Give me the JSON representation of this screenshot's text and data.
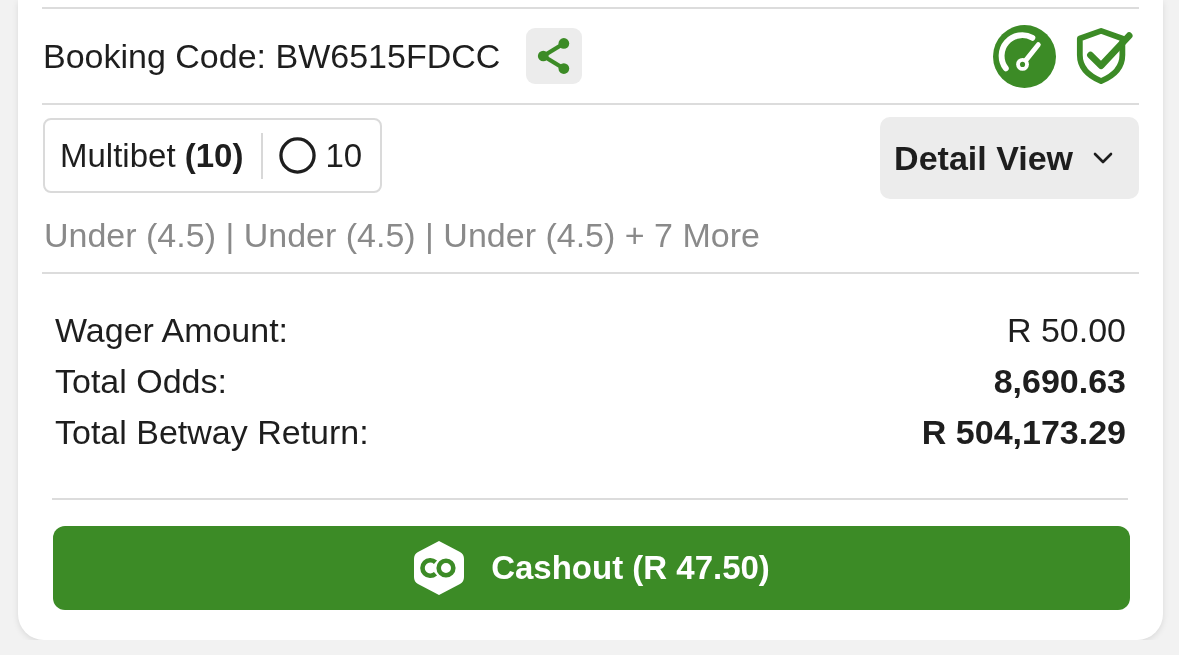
{
  "booking": {
    "text": "Booking Code: BW6515FDCC"
  },
  "bet": {
    "type_label": "Multibet **(10)**",
    "selection_count": "10"
  },
  "view_toggle": {
    "label": "Detail View"
  },
  "selections_summary": "Under (4.5) | Under (4.5) | Under (4.5) + 7 More",
  "details": [
    {
      "label": "Wager Amount:",
      "value": "R 50.00",
      "bold": false
    },
    {
      "label": "Total Odds:",
      "value": "8,690.63",
      "bold": true
    },
    {
      "label": "Total Betway Return:",
      "value": "R 504,173.29",
      "bold": true
    }
  ],
  "cashout_button": {
    "label": "Cashout (R 47.50)"
  }
}
